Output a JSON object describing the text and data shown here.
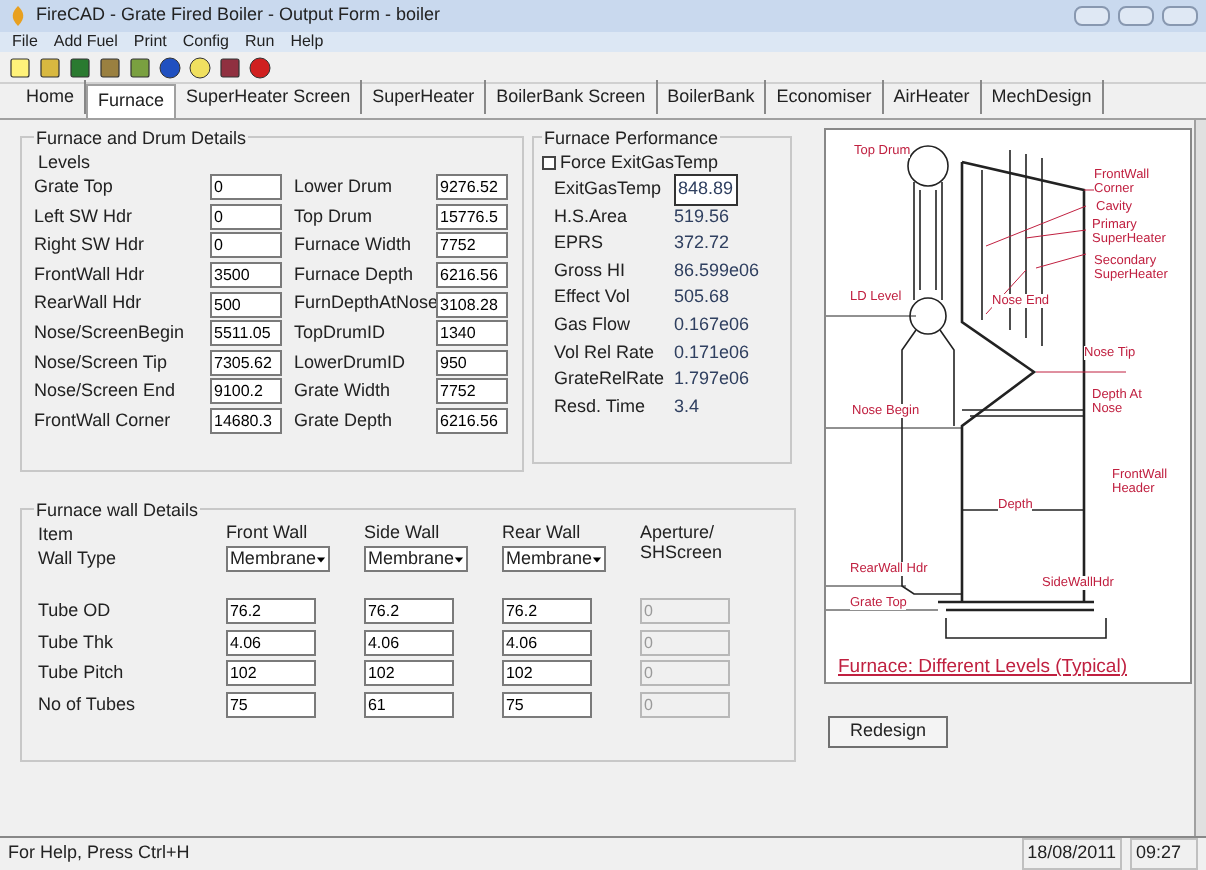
{
  "window": {
    "title": "FireCAD - Grate Fired Boiler - Output Form - boiler"
  },
  "menu": [
    "File",
    "Add Fuel",
    "Print",
    "Config",
    "Run",
    "Help"
  ],
  "tabs": [
    {
      "label": "Home",
      "selected": false
    },
    {
      "label": "Furnace",
      "selected": true
    },
    {
      "label": "SuperHeater Screen",
      "selected": false
    },
    {
      "label": "SuperHeater",
      "selected": false
    },
    {
      "label": "BoilerBank Screen",
      "selected": false
    },
    {
      "label": "BoilerBank",
      "selected": false
    },
    {
      "label": "Economiser",
      "selected": false
    },
    {
      "label": "AirHeater",
      "selected": false
    },
    {
      "label": "MechDesign",
      "selected": false
    }
  ],
  "drum_details": {
    "title": "Furnace and Drum Details",
    "subtitle": "Levels",
    "left": [
      {
        "label": "Grate Top",
        "value": "0"
      },
      {
        "label": "Left SW Hdr",
        "value": "0"
      },
      {
        "label": "Right SW Hdr",
        "value": "0"
      },
      {
        "label": "FrontWall Hdr",
        "value": "3500"
      },
      {
        "label": "RearWall Hdr",
        "value": "500"
      },
      {
        "label": "Nose/ScreenBegin",
        "value": "5511.05"
      },
      {
        "label": "Nose/Screen Tip",
        "value": "7305.62"
      },
      {
        "label": "Nose/Screen End",
        "value": "9100.2"
      },
      {
        "label": "FrontWall Corner",
        "value": "14680.3"
      }
    ],
    "right": [
      {
        "label": "Lower Drum",
        "value": "9276.52"
      },
      {
        "label": "Top Drum",
        "value": "15776.5"
      },
      {
        "label": "Furnace Width",
        "value": "7752"
      },
      {
        "label": "Furnace Depth",
        "value": "6216.56"
      },
      {
        "label": "FurnDepthAtNose",
        "value": "3108.28"
      },
      {
        "label": "TopDrumID",
        "value": "1340"
      },
      {
        "label": "LowerDrumID",
        "value": "950"
      },
      {
        "label": "Grate Width",
        "value": "7752"
      },
      {
        "label": "Grate Depth",
        "value": "6216.56"
      }
    ]
  },
  "performance": {
    "title": "Furnace Performance",
    "force_checkbox": {
      "label": "Force ExitGasTemp",
      "checked": false
    },
    "rows": [
      {
        "label": "ExitGasTemp",
        "value": "848.89",
        "kind": "field"
      },
      {
        "label": "H.S.Area",
        "value": "519.56",
        "kind": "text"
      },
      {
        "label": "EPRS",
        "value": "372.72",
        "kind": "text"
      },
      {
        "label": "Gross HI",
        "value": "86.599e06",
        "kind": "text"
      },
      {
        "label": "Effect Vol",
        "value": "505.68",
        "kind": "text"
      },
      {
        "label": "Gas Flow",
        "value": "0.167e06",
        "kind": "text"
      },
      {
        "label": "Vol Rel Rate",
        "value": "0.171e06",
        "kind": "text"
      },
      {
        "label": "GrateRelRate",
        "value": "1.797e06",
        "kind": "text"
      },
      {
        "label": "Resd. Time",
        "value": "3.4",
        "kind": "text"
      }
    ]
  },
  "diagram": {
    "labels": [
      "Top Drum",
      "FrontWall Corner",
      "Cavity",
      "Primary SuperHeater",
      "Secondary SuperHeater",
      "LD Level",
      "Nose End",
      "Nose Tip",
      "Nose Begin",
      "Depth At Nose",
      "FrontWall Header",
      "Depth",
      "RearWall Hdr",
      "SideWallHdr",
      "Grate Top"
    ],
    "caption": "Furnace: Different Levels (Typical)"
  },
  "redesign_button": "Redesign",
  "wall_details": {
    "title": "Furnace wall Details",
    "item_header": "Item",
    "type_label": "Wall Type",
    "columns": [
      {
        "header": "Front Wall",
        "wall_type": "Membrane",
        "disabled": false
      },
      {
        "header": "Side Wall",
        "wall_type": "Membrane",
        "disabled": false
      },
      {
        "header": "Rear Wall",
        "wall_type": "Membrane",
        "disabled": false
      },
      {
        "header": "Aperture/ SHScreen",
        "disabled": true
      }
    ],
    "rows": [
      {
        "label": "Tube OD",
        "values": [
          "76.2",
          "76.2",
          "76.2",
          "0"
        ]
      },
      {
        "label": "Tube Thk",
        "values": [
          "4.06",
          "4.06",
          "4.06",
          "0"
        ]
      },
      {
        "label": "Tube Pitch",
        "values": [
          "102",
          "102",
          "102",
          "0"
        ]
      },
      {
        "label": "No of Tubes",
        "values": [
          "75",
          "61",
          "75",
          "0"
        ]
      }
    ]
  },
  "status_bar": {
    "help": "For Help, Press Ctrl+H",
    "date": "18/08/2011",
    "time": "09:27"
  }
}
